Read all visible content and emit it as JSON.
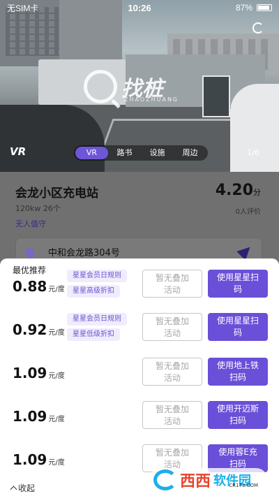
{
  "status_bar": {
    "carrier": "无SIM卡",
    "time": "10:26",
    "battery": "87%"
  },
  "hero": {
    "watermark": "找桩",
    "watermark_sub": "ZHAOZHUANG",
    "vr_logo": "VR",
    "tabs": [
      {
        "label": "VR",
        "active": true
      },
      {
        "label": "路书",
        "active": false
      },
      {
        "label": "设施",
        "active": false
      },
      {
        "label": "周边",
        "active": false
      }
    ],
    "pager": "1/6"
  },
  "station": {
    "name": "会龙小区充电站",
    "spec": "120kw 26个",
    "tag": "无人值守",
    "rating": "4.20",
    "rating_unit": "分",
    "rating_count": "0人评价",
    "address": "中和会龙路304号"
  },
  "sheet": {
    "title": "最优推荐",
    "rows": [
      {
        "price": "0.88",
        "unit": "元/度",
        "chips": [
          "星星会员日规则",
          "星星高级折扣"
        ],
        "btn_gray": [
          "暂无叠加",
          "活动"
        ],
        "btn_action": [
          "使用星星扫",
          "码"
        ]
      },
      {
        "price": "0.92",
        "unit": "元/度",
        "chips": [
          "星星会员日规则",
          "星星低级折扣"
        ],
        "btn_gray": [
          "暂无叠加",
          "活动"
        ],
        "btn_action": [
          "使用星星扫",
          "码"
        ]
      },
      {
        "price": "1.09",
        "unit": "元/度",
        "chips": [],
        "btn_gray": [
          "暂无叠加",
          "活动"
        ],
        "btn_action": [
          "使用地上铁",
          "扫码"
        ]
      },
      {
        "price": "1.09",
        "unit": "元/度",
        "chips": [],
        "btn_gray": [
          "暂无叠加",
          "活动"
        ],
        "btn_action": [
          "使用开迈斯",
          "扫码"
        ]
      },
      {
        "price": "1.09",
        "unit": "元/度",
        "chips": [],
        "btn_gray": [
          "暂无叠加",
          "活动"
        ],
        "btn_action": [
          "使用蓉E充",
          "扫码"
        ]
      }
    ],
    "collapse_label": "收起"
  },
  "site_logo": {
    "text1": "西西",
    "text2": "软件园",
    "url_text": "CR173.COM"
  },
  "colors": {
    "accent": "#6a4fd8",
    "chip_text": "#6a55d0",
    "chip_bg": "#f0ecfc"
  }
}
